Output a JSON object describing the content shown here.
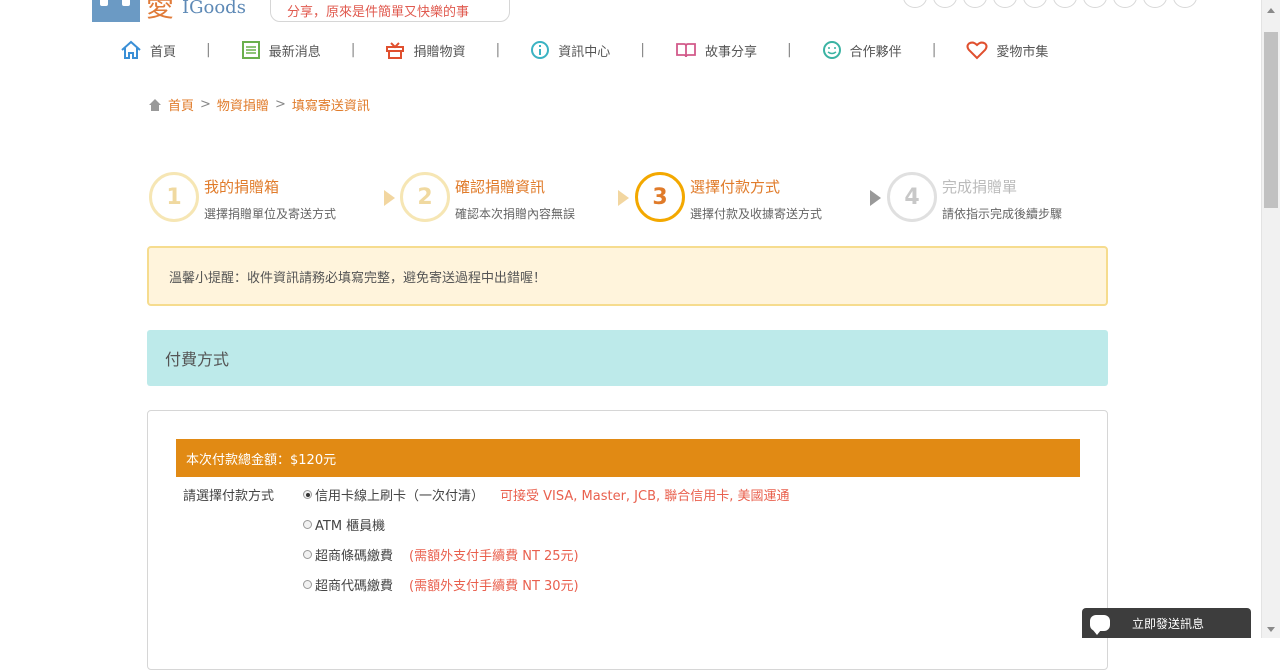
{
  "header": {
    "logo_main": "愛",
    "logo_sub": "IGoods",
    "slogan": "分享，原來是件簡單又快樂的事"
  },
  "nav": {
    "items": [
      {
        "label": "首頁",
        "icon": "home-icon",
        "color": "#3a8fd6"
      },
      {
        "label": "最新消息",
        "icon": "list-icon",
        "color": "#6ab04c"
      },
      {
        "label": "捐贈物資",
        "icon": "gift-icon",
        "color": "#e0502f"
      },
      {
        "label": "資訊中心",
        "icon": "info-icon",
        "color": "#3bb3c3"
      },
      {
        "label": "故事分享",
        "icon": "book-icon",
        "color": "#d25a8a"
      },
      {
        "label": "合作夥伴",
        "icon": "smile-icon",
        "color": "#3bb3a3"
      },
      {
        "label": "愛物市集",
        "icon": "heart-icon",
        "color": "#e0502f"
      }
    ],
    "separator": "|"
  },
  "breadcrumb": {
    "items": [
      "首頁",
      "物資捐贈",
      "填寫寄送資訊"
    ],
    "separator": ">"
  },
  "steps": [
    {
      "number": "1",
      "title": "我的捐贈箱",
      "desc": "選擇捐贈單位及寄送方式",
      "state": "done"
    },
    {
      "number": "2",
      "title": "確認捐贈資訊",
      "desc": "確認本次捐贈內容無誤",
      "state": "done"
    },
    {
      "number": "3",
      "title": "選擇付款方式",
      "desc": "選擇付款及收據寄送方式",
      "state": "active"
    },
    {
      "number": "4",
      "title": "完成捐贈單",
      "desc": "請依指示完成後續步驟",
      "state": "inactive"
    }
  ],
  "notice": "溫馨小提醒：收件資訊請務必填寫完整，避免寄送過程中出錯喔！",
  "payment": {
    "section_title": "付費方式",
    "total_label": "本次付款總金額：$120元",
    "choose_label": "請選擇付款方式",
    "options": [
      {
        "label": "信用卡線上刷卡（一次付清）",
        "note": "可接受 VISA, Master, JCB, 聯合信用卡, 美國運通",
        "selected": true
      },
      {
        "label": "ATM 櫃員機",
        "note": "",
        "selected": false
      },
      {
        "label": "超商條碼繳費",
        "note": "(需額外支付手續費 NT 25元)",
        "selected": false
      },
      {
        "label": "超商代碼繳費",
        "note": "(需額外支付手續費 NT 30元)",
        "selected": false
      }
    ]
  },
  "chat": {
    "label": "立即發送訊息"
  },
  "colors": {
    "accent_orange": "#e07b2a",
    "amount_bar": "#e18a14",
    "section_teal": "#bdeaea",
    "notice_bg": "#fff4dc",
    "note_red": "#e9604e"
  }
}
